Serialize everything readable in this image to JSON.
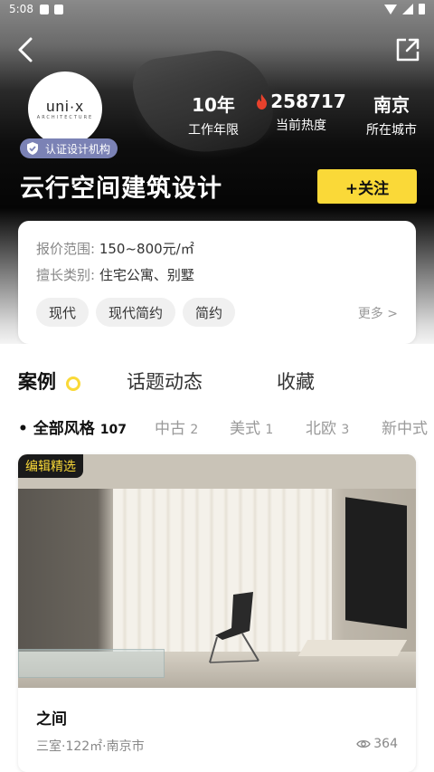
{
  "status_bar": {
    "time": "5:08"
  },
  "profile": {
    "logo_text": "uni·x",
    "logo_sub": "ARCHITECTURE",
    "badge": "认证设计机构",
    "name": "云行空间建筑设计",
    "follow_label": "+关注",
    "stats": [
      {
        "value": "10年",
        "label": "工作年限"
      },
      {
        "value": "258717",
        "label": "当前热度",
        "icon": "flame-icon"
      },
      {
        "value": "南京",
        "label": "所在城市"
      }
    ]
  },
  "info_card": {
    "price_label": "报价范围:",
    "price_value": "150~800元/㎡",
    "category_label": "擅长类别:",
    "category_value": "住宅公寓、别墅",
    "tags": [
      "现代",
      "现代简约",
      "简约"
    ],
    "more_label": "更多 >"
  },
  "tabs": [
    {
      "label": "案例",
      "active": true
    },
    {
      "label": "话题动态",
      "active": false
    },
    {
      "label": "收藏",
      "active": false
    }
  ],
  "filters": [
    {
      "label": "全部风格",
      "count": "107",
      "active": true
    },
    {
      "label": "中古",
      "count": "2",
      "active": false
    },
    {
      "label": "美式",
      "count": "1",
      "active": false
    },
    {
      "label": "北欧",
      "count": "3",
      "active": false
    },
    {
      "label": "新中式",
      "count": "",
      "active": false
    }
  ],
  "case_card": {
    "tag": "编辑精选",
    "title": "之间",
    "meta": "三室·122㎡·南京市",
    "views": "364"
  },
  "colors": {
    "accent": "#fad938",
    "badge": "#7b82b5",
    "flame": "#e8412c"
  }
}
